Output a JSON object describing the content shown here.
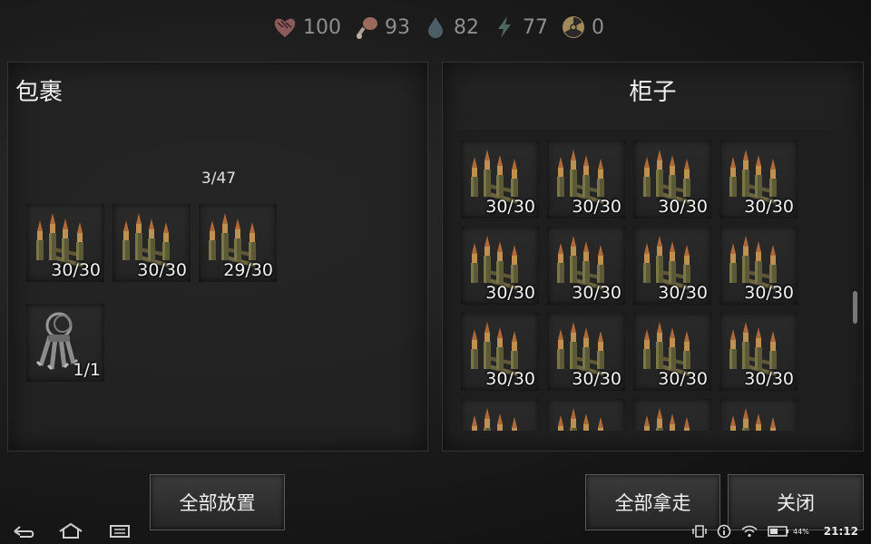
{
  "stats": [
    {
      "name": "health",
      "icon": "heart-icon",
      "value": "100"
    },
    {
      "name": "food",
      "icon": "meat-icon",
      "value": "93"
    },
    {
      "name": "water",
      "icon": "water-drop-icon",
      "value": "82"
    },
    {
      "name": "energy",
      "icon": "lightning-icon",
      "value": "77"
    },
    {
      "name": "radiation",
      "icon": "radiation-icon",
      "value": "0"
    }
  ],
  "backpack": {
    "title": "包裹",
    "capacity": "3/47",
    "items": [
      {
        "icon": "rifle-ammo-icon",
        "qty": "30/30"
      },
      {
        "icon": "rifle-ammo-icon",
        "qty": "30/30"
      },
      {
        "icon": "rifle-ammo-icon",
        "qty": "29/30"
      },
      {
        "icon": "keys-icon",
        "qty": "1/1"
      }
    ],
    "put_all_label": "全部放置"
  },
  "cabinet": {
    "title": "柜子",
    "items": [
      {
        "icon": "rifle-ammo-icon",
        "qty": "30/30"
      },
      {
        "icon": "rifle-ammo-icon",
        "qty": "30/30"
      },
      {
        "icon": "rifle-ammo-icon",
        "qty": "30/30"
      },
      {
        "icon": "rifle-ammo-icon",
        "qty": "30/30"
      },
      {
        "icon": "rifle-ammo-icon",
        "qty": "30/30"
      },
      {
        "icon": "rifle-ammo-icon",
        "qty": "30/30"
      },
      {
        "icon": "rifle-ammo-icon",
        "qty": "30/30"
      },
      {
        "icon": "rifle-ammo-icon",
        "qty": "30/30"
      },
      {
        "icon": "rifle-ammo-icon",
        "qty": "30/30"
      },
      {
        "icon": "rifle-ammo-icon",
        "qty": "30/30"
      },
      {
        "icon": "rifle-ammo-icon",
        "qty": "30/30"
      },
      {
        "icon": "rifle-ammo-icon",
        "qty": "30/30"
      },
      {
        "icon": "rifle-ammo-icon",
        "qty": ""
      },
      {
        "icon": "rifle-ammo-icon",
        "qty": ""
      },
      {
        "icon": "rifle-ammo-icon",
        "qty": ""
      },
      {
        "icon": "rifle-ammo-icon",
        "qty": ""
      }
    ],
    "take_all_label": "全部拿走",
    "close_label": "关闭"
  },
  "system": {
    "battery": "44%",
    "time": "21:12"
  }
}
